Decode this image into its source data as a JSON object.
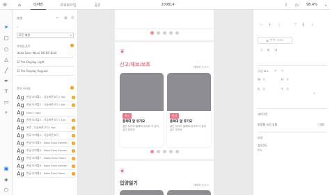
{
  "titlebar": {
    "tabs": [
      "디자인",
      "프로토타입",
      "공유"
    ],
    "active_tab": 0,
    "doc_title": "200814",
    "zoom": "98.4%"
  },
  "layers": {
    "header": "에셋",
    "search_value": "모든 에셋",
    "plugins_label": "가져온 폰트",
    "plugin_items": [
      "Hoda Sans Mono OK KR Bold",
      "SF Pro Display Light",
      "SF Pro Display Regular"
    ],
    "styles_label": "문자 스타일",
    "style_items": [
      "한글 타이틀1 - 나눔바른고딕 / 9pt",
      "한글 타이틀2 - 나눔바른고딕 / 6pt",
      "form / labe",
      "한글 타이틀3 - 나눔바른고딕 / 1pt",
      "본문 - 나눔바른고딕 / 9pt",
      "한글 타이틀4 - 나눔바른고딕",
      "한글 타이틀5 - Noto Sans Korean",
      "한글 타이틀6 - Noto Sans Korean",
      "한글 타이틀7 - Hoda Sans Mono",
      "한글 타이틀8 - Noto Sans Korean",
      "한글 타이틀9 - Noto Sans Mono"
    ],
    "style_glyph": "Ag",
    "badge_text": "!"
  },
  "canvas": {
    "section1_title": "신고/제보/보호",
    "section1_more": "더보기 >>>",
    "cards": [
      {
        "tag": "신고",
        "title": "충북대 앞 유기묘",
        "desc": "골든 뒤거리 올해에 유기묘 가 꿈이 살고 있어요"
      },
      {
        "tag": "신고",
        "title": "충북대 앞 유기묘",
        "desc": "골든 뒤거리 올해에 유기묘 가 꿈이 살고 있어요"
      }
    ],
    "section2_title": "입양일기",
    "section2_more": "더보기 >>>"
  },
  "props": {
    "repeat_grid": "반복 그리드",
    "layout_label": "구성 요소",
    "w_label": "W",
    "h_label": "H",
    "x_label": "X",
    "y_label": "Y",
    "w_value": "0",
    "h_value": "0",
    "x_value": "0",
    "y_value": "0",
    "responsive_label": "레이아웃",
    "responsive_resize": "반응형 크기 조정",
    "appearance_label": "모양",
    "opacity_label": "불투명도",
    "opacity_value": "0%"
  },
  "colors": {
    "accent_pink": "#e57a8a",
    "image_gray": "#8e8e92",
    "badge_orange": "#f39c12"
  }
}
